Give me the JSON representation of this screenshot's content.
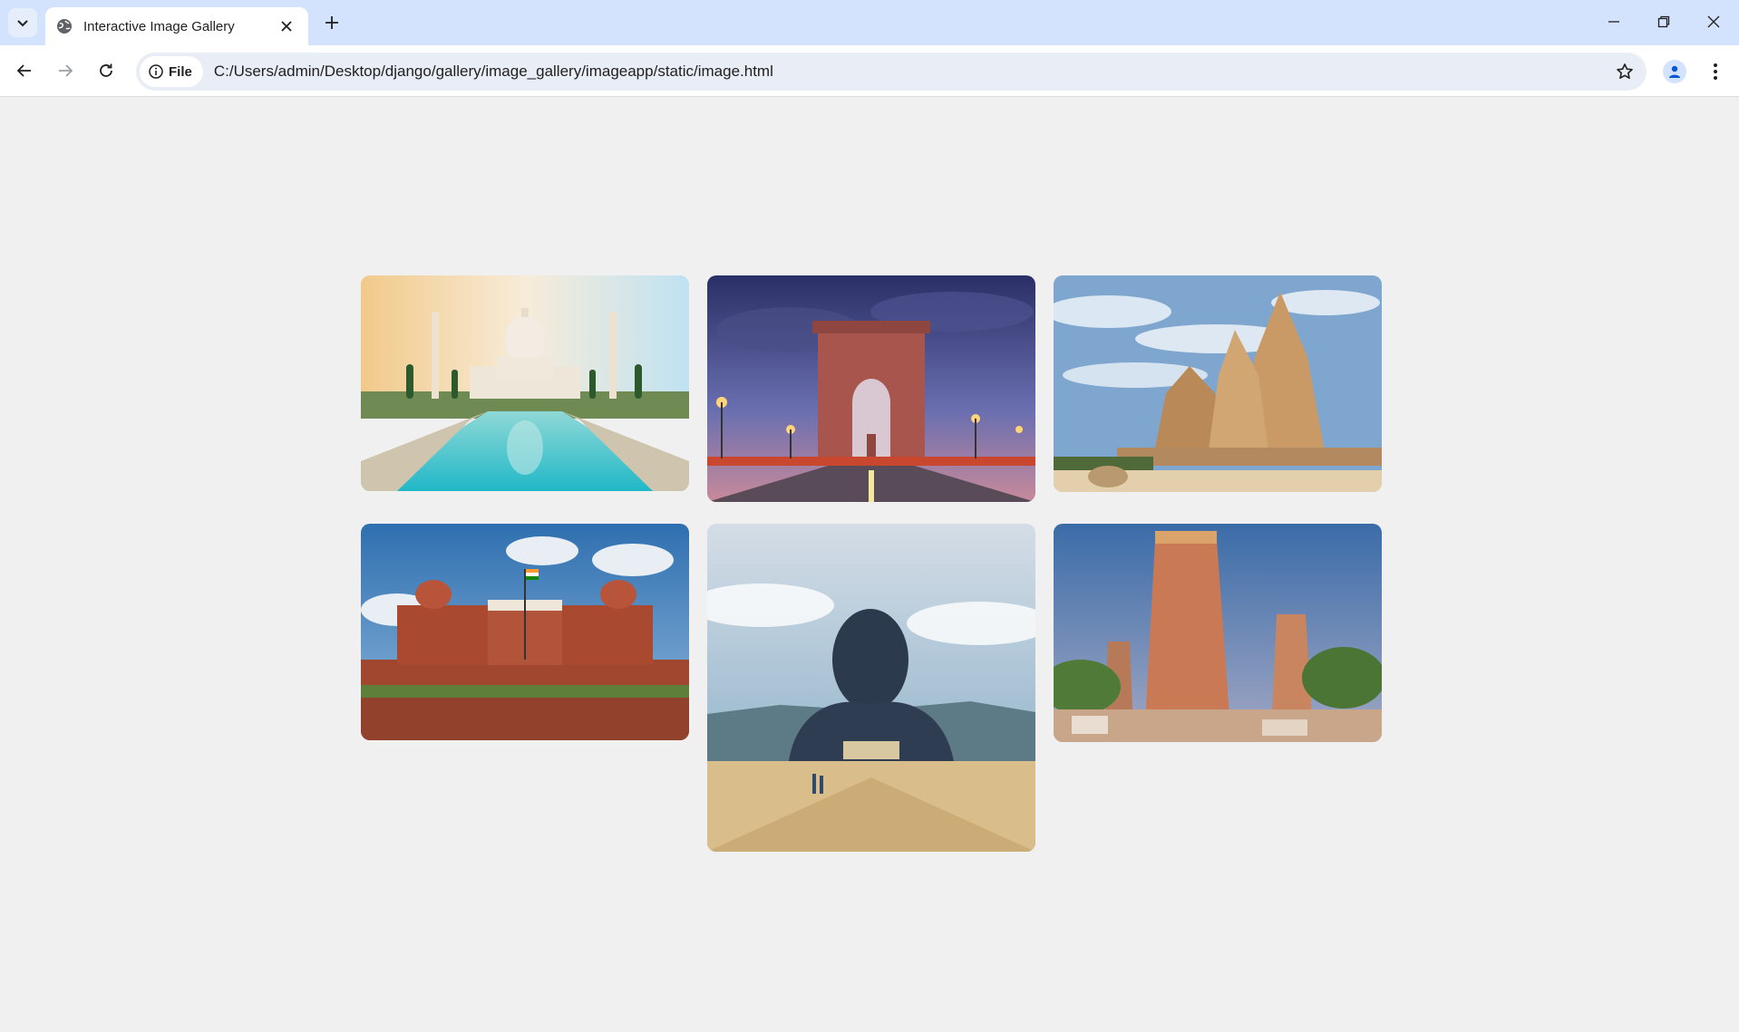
{
  "browser": {
    "tab": {
      "title": "Interactive Image Gallery"
    },
    "omnibox": {
      "chip_label": "File",
      "url": "C:/Users/admin/Desktop/django/gallery/image_gallery/imageapp/static/image.html"
    },
    "icons": {
      "tab_search": "chevron-down-icon",
      "favicon": "globe-icon",
      "tab_close": "close-icon",
      "new_tab": "plus-icon",
      "back": "arrow-left-icon",
      "forward": "arrow-right-icon",
      "reload": "reload-icon",
      "site_info": "info-icon",
      "bookmark": "star-icon",
      "profile": "person-icon",
      "menu": "kebab-menu-icon",
      "minimize": "minimize-icon",
      "restore": "restore-icon",
      "close_window": "close-icon"
    }
  },
  "gallery": {
    "images": [
      {
        "subject": "taj-mahal"
      },
      {
        "subject": "india-gate"
      },
      {
        "subject": "khajuraho-temple"
      },
      {
        "subject": "red-fort"
      },
      {
        "subject": "adiyogi-statue"
      },
      {
        "subject": "meenakshi-temple"
      }
    ]
  },
  "colors": {
    "page_background": "#f0f0f0",
    "tabstrip": "#d3e3fd",
    "omnibox": "#e9eef6"
  }
}
